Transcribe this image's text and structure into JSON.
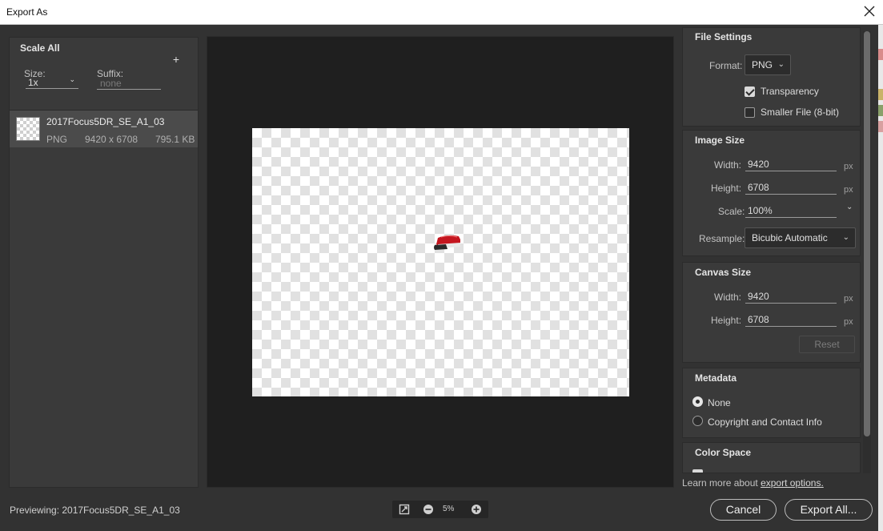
{
  "window": {
    "title": "Export As",
    "close_icon": "close-icon"
  },
  "left": {
    "scale_title": "Scale All",
    "size_label": "Size:",
    "size_value": "1x",
    "suffix_label": "Suffix:",
    "suffix_placeholder": "none",
    "add_label": "+",
    "asset": {
      "name": "2017Focus5DR_SE_A1_03",
      "format": "PNG",
      "dimensions": "9420 x 6708",
      "filesize": "795.1 KB"
    }
  },
  "file_settings": {
    "title": "File Settings",
    "format_label": "Format:",
    "format_value": "PNG",
    "transparency_label": "Transparency",
    "transparency_checked": true,
    "smaller_file_label": "Smaller File (8-bit)",
    "smaller_file_checked": false
  },
  "image_size": {
    "title": "Image Size",
    "width_label": "Width:",
    "width_value": "9420",
    "height_label": "Height:",
    "height_value": "6708",
    "scale_label": "Scale:",
    "scale_value": "100%",
    "resample_label": "Resample:",
    "resample_value": "Bicubic Automatic",
    "unit": "px"
  },
  "canvas_size": {
    "title": "Canvas Size",
    "width_label": "Width:",
    "width_value": "9420",
    "height_label": "Height:",
    "height_value": "6708",
    "unit": "px",
    "reset_label": "Reset"
  },
  "metadata": {
    "title": "Metadata",
    "options": [
      "None",
      "Copyright and Contact Info"
    ],
    "selected": "None"
  },
  "color_space": {
    "title": "Color Space"
  },
  "learn_more": {
    "prefix": "Learn more about ",
    "link": "export options."
  },
  "footer": {
    "previewing": "Previewing: 2017Focus5DR_SE_A1_03",
    "zoom": "5%",
    "cancel_label": "Cancel",
    "export_label": "Export All..."
  },
  "colors": {
    "accent": "#c0202a",
    "panel": "#3a3a3a",
    "background": "#323232"
  }
}
